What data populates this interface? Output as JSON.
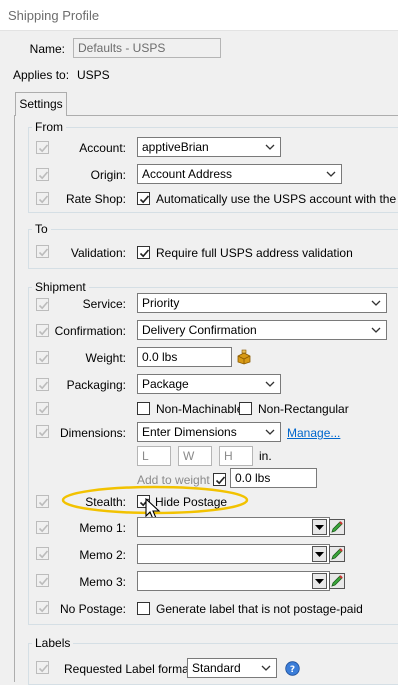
{
  "window": {
    "title": "Shipping Profile"
  },
  "profile": {
    "name_label": "Name:",
    "name_value": "Defaults - USPS",
    "applies_label": "Applies to:",
    "applies_value": "USPS"
  },
  "tabs": {
    "settings": "Settings"
  },
  "from": {
    "legend": "From",
    "account_label": "Account:",
    "account_value": "apptiveBrian",
    "origin_label": "Origin:",
    "origin_value": "Account Address",
    "rateshop_label": "Rate Shop:",
    "rateshop_text": "Automatically use the USPS account with the least"
  },
  "to": {
    "legend": "To",
    "validation_label": "Validation:",
    "validation_text": "Require full USPS address validation"
  },
  "shipment": {
    "legend": "Shipment",
    "service_label": "Service:",
    "service_value": "Priority",
    "confirmation_label": "Confirmation:",
    "confirmation_value": "Delivery Confirmation",
    "weight_label": "Weight:",
    "weight_value": "0.0 lbs",
    "packaging_label": "Packaging:",
    "packaging_value": "Package",
    "nonmachinable_text": "Non-Machinable",
    "nonrectangular_text": "Non-Rectangular",
    "dimensions_label": "Dimensions:",
    "dimensions_value": "Enter Dimensions",
    "manage_link": "Manage...",
    "dim_l_placeholder": "L",
    "dim_w_placeholder": "W",
    "dim_h_placeholder": "H",
    "dim_unit": "in.",
    "add_to_weight_label": "Add to weight",
    "add_weight_value": "0.0 lbs",
    "stealth_label": "Stealth:",
    "stealth_text": "Hide Postage",
    "memo1_label": "Memo 1:",
    "memo2_label": "Memo 2:",
    "memo3_label": "Memo 3:",
    "nopostage_label": "No Postage:",
    "nopostage_text": "Generate label that is not postage-paid"
  },
  "labels": {
    "legend": "Labels",
    "format_label": "Requested Label format:",
    "format_value": "Standard"
  },
  "colors": {
    "highlight_ellipse": "#f2c200",
    "link": "#0066cc",
    "help_icon": "#3b7dd8"
  },
  "icons": {
    "weight_scale": "scale-icon",
    "memo_edit": "pencil-icon",
    "help": "help-icon",
    "cursor": "mouse-cursor-icon"
  }
}
